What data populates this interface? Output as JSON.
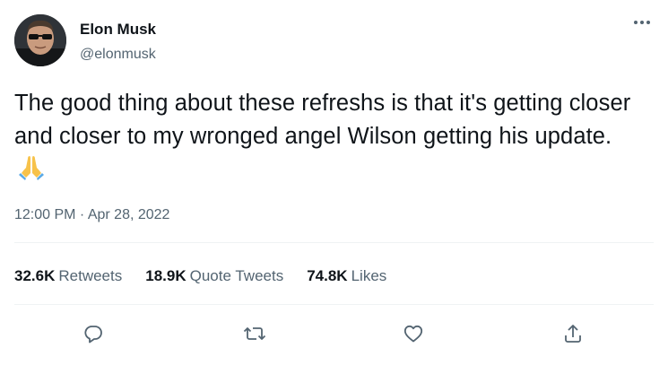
{
  "author": {
    "name": "Elon Musk",
    "handle": "@elonmusk"
  },
  "tweet": {
    "text": "The good thing about these refreshs is that it's getting closer and closer to my wronged angel Wilson getting his update.",
    "emoji": "folded-hands-emoji",
    "timestamp": "12:00 PM · Apr 28, 2022"
  },
  "stats": {
    "retweets": {
      "count": "32.6K",
      "label": "Retweets"
    },
    "quote_tweets": {
      "count": "18.9K",
      "label": "Quote Tweets"
    },
    "likes": {
      "count": "74.8K",
      "label": "Likes"
    }
  },
  "icons": {
    "more": "more-icon",
    "reply": "reply-icon",
    "retweet": "retweet-icon",
    "like": "heart-icon",
    "share": "share-icon"
  },
  "colors": {
    "text": "#0f1419",
    "secondary": "#536471",
    "divider": "#eff3f4"
  }
}
